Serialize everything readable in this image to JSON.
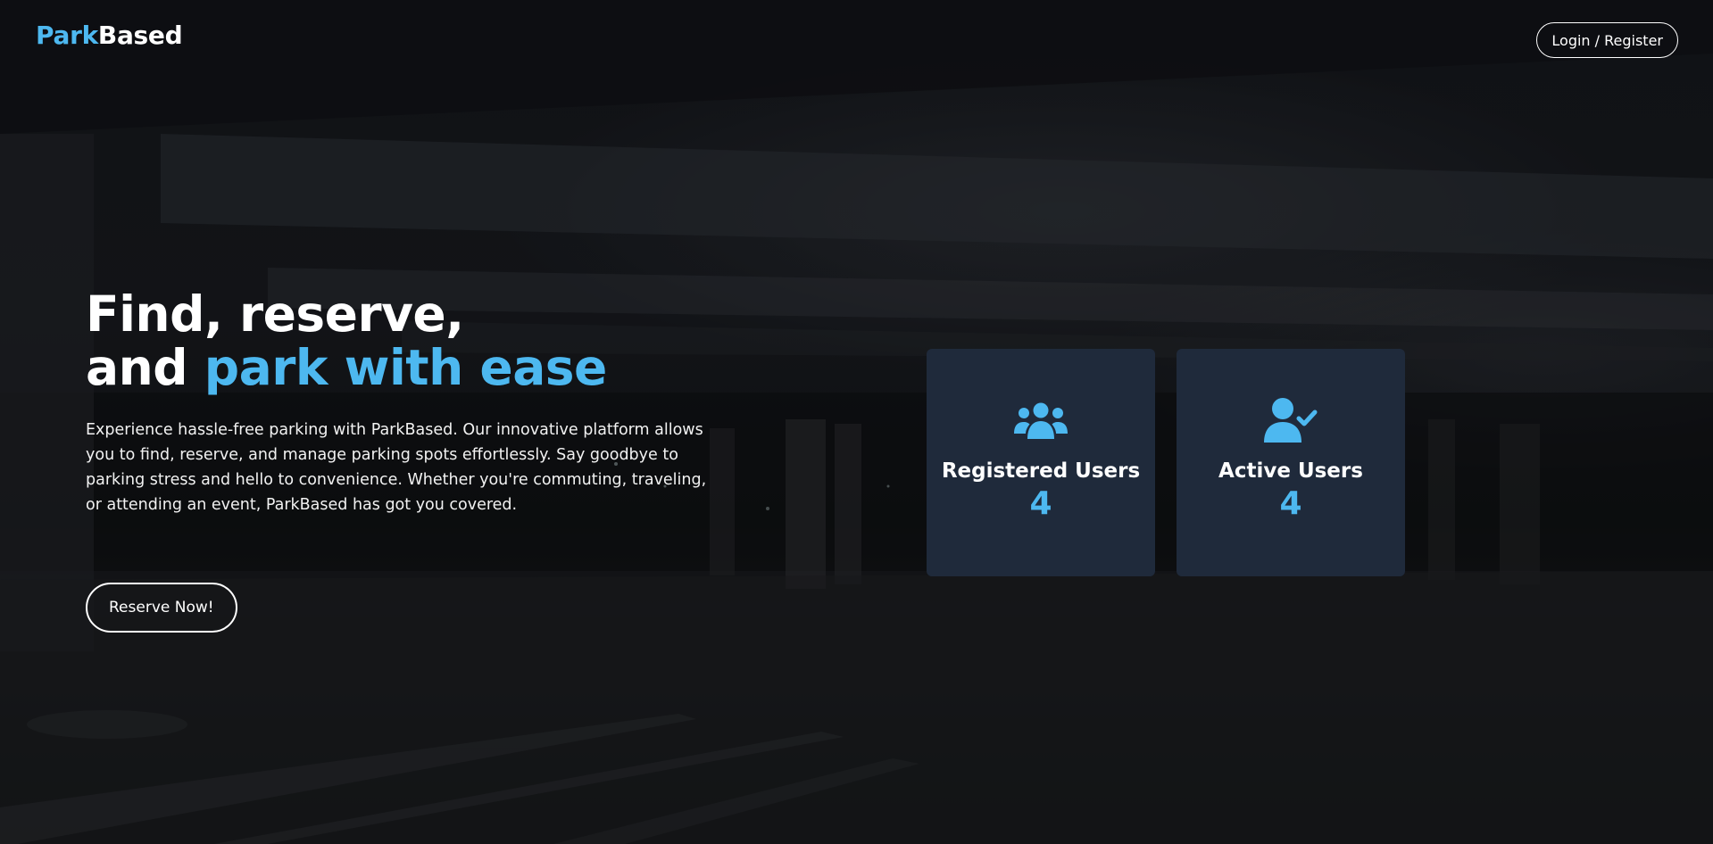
{
  "brand": {
    "name_part1": "Park",
    "name_part2": "Based",
    "accent_color": "#4db8f0"
  },
  "header": {
    "login_label": "Login / Register"
  },
  "hero": {
    "title_line1": "Find, reserve,",
    "title_line2_plain": "and ",
    "title_line2_accent": "park with ease",
    "description": "Experience hassle-free parking with ParkBased. Our innovative platform allows you to find, reserve, and manage parking spots effortlessly. Say goodbye to parking stress and hello to convenience. Whether you're commuting, traveling, or attending an event, ParkBased has got you covered.",
    "cta_label": "Reserve Now!"
  },
  "stats": [
    {
      "label": "Registered Users",
      "value": "4",
      "icon": "users-icon"
    },
    {
      "label": "Active Users",
      "value": "4",
      "icon": "user-check-icon"
    }
  ],
  "colors": {
    "card_background": "#1f2a3b",
    "accent": "#4db8f0",
    "text": "#ffffff"
  }
}
